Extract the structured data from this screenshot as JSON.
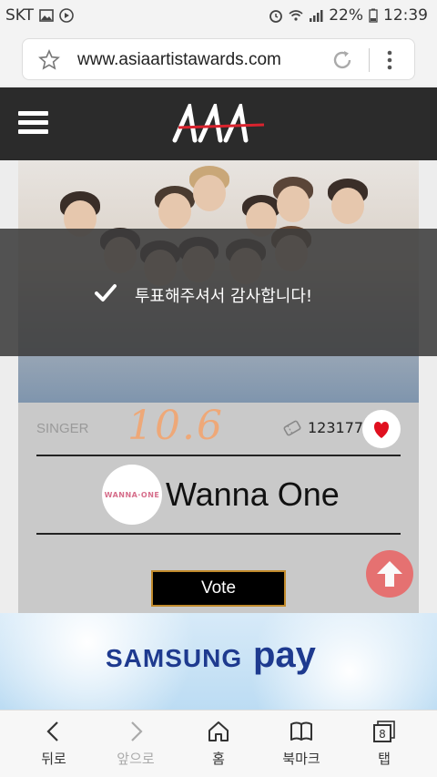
{
  "status_bar": {
    "carrier": "SKT",
    "battery": "22%",
    "time": "12:39"
  },
  "browser": {
    "url": "www.asiaartistawards.com"
  },
  "toast": {
    "message": "투표해주셔서 감사합니다!"
  },
  "card": {
    "category": "SINGER",
    "handwritten_note": "10.6",
    "vote_count": "123177",
    "artist_logo_text": "WANNA·ONE",
    "artist_name": "Wanna One",
    "vote_button": "Vote"
  },
  "ad": {
    "brand": "SAMSUNG",
    "product": "pay"
  },
  "bottom_nav": {
    "back": "뒤로",
    "forward": "앞으로",
    "home": "홈",
    "bookmarks": "북마크",
    "tabs": "탭",
    "tab_count": "8"
  },
  "colors": {
    "header_bg": "#2b2b2b",
    "card_bg": "#c9c9c9",
    "heart": "#e0101f",
    "scroll_top": "#e86a6a",
    "ad_text": "#1e3a8f"
  }
}
